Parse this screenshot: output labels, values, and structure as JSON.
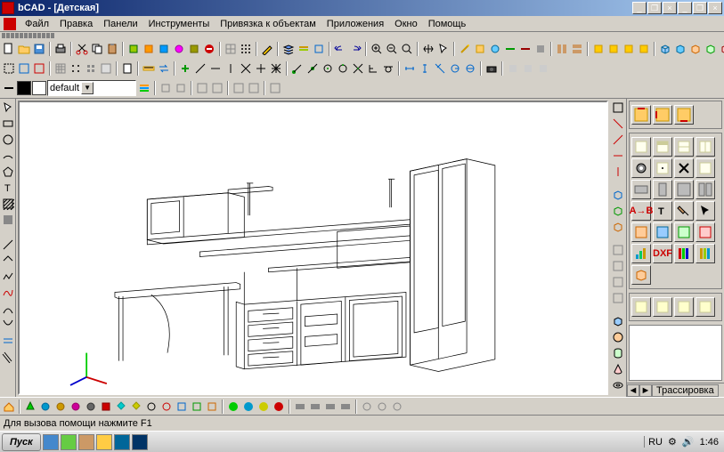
{
  "window": {
    "title": "bCAD - [Детская]"
  },
  "menu": {
    "items": [
      "Файл",
      "Правка",
      "Панели",
      "Инструменты",
      "Привязка к объектам",
      "Приложения",
      "Окно",
      "Помощь"
    ]
  },
  "layer": {
    "current": "default"
  },
  "status": {
    "help": "Для вызова помощи нажмите F1"
  },
  "sidepanel": {
    "tab": "Трассировка",
    "dxf_label": "DXF",
    "ab_label": "A→B"
  },
  "taskbar": {
    "start": "Пуск",
    "lang": "RU",
    "time": "1:46"
  },
  "colors": {
    "fg": "#000000",
    "bg": "#ffffff"
  }
}
